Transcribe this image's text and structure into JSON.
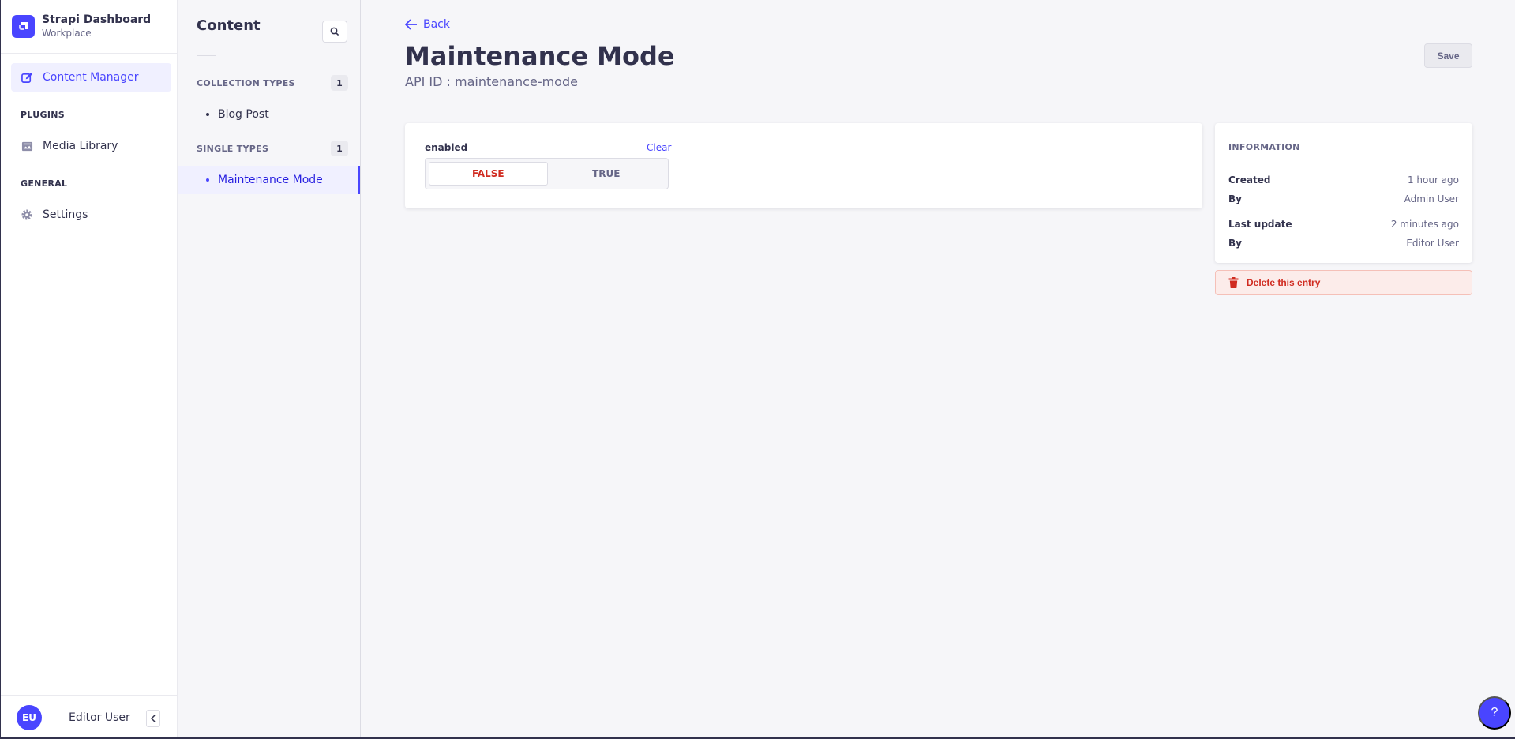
{
  "brand": {
    "title": "Strapi Dashboard",
    "subtitle": "Workplace"
  },
  "mainnav": {
    "items": [
      {
        "label": "Content Manager",
        "icon": "pencil-icon"
      },
      {
        "label": "Media Library",
        "icon": "image-icon"
      },
      {
        "label": "Settings",
        "icon": "gear-icon"
      }
    ],
    "sections": {
      "plugins": "PLUGINS",
      "general": "GENERAL"
    },
    "footer": {
      "initials": "EU",
      "name": "Editor User"
    }
  },
  "subnav": {
    "title": "Content",
    "collection": {
      "label": "COLLECTION TYPES",
      "count": "1",
      "items": [
        "Blog Post"
      ]
    },
    "single": {
      "label": "SINGLE TYPES",
      "count": "1",
      "items": [
        "Maintenance Mode"
      ]
    }
  },
  "main": {
    "back": "Back",
    "title": "Maintenance Mode",
    "api_id": "API ID : maintenance-mode",
    "save": "Save",
    "field": {
      "label": "enabled",
      "clear": "Clear",
      "false": "FALSE",
      "true": "TRUE"
    }
  },
  "info": {
    "title": "INFORMATION",
    "rows": [
      {
        "key": "Created",
        "value": "1 hour ago"
      },
      {
        "key": "By",
        "value": "Admin User"
      },
      {
        "key": "Last update",
        "value": "2 minutes ago"
      },
      {
        "key": "By",
        "value": "Editor User"
      }
    ],
    "delete": "Delete this entry"
  },
  "help": "?",
  "colors": {
    "primary": "#4945ff",
    "danger": "#d02b20",
    "text": "#32324d"
  }
}
